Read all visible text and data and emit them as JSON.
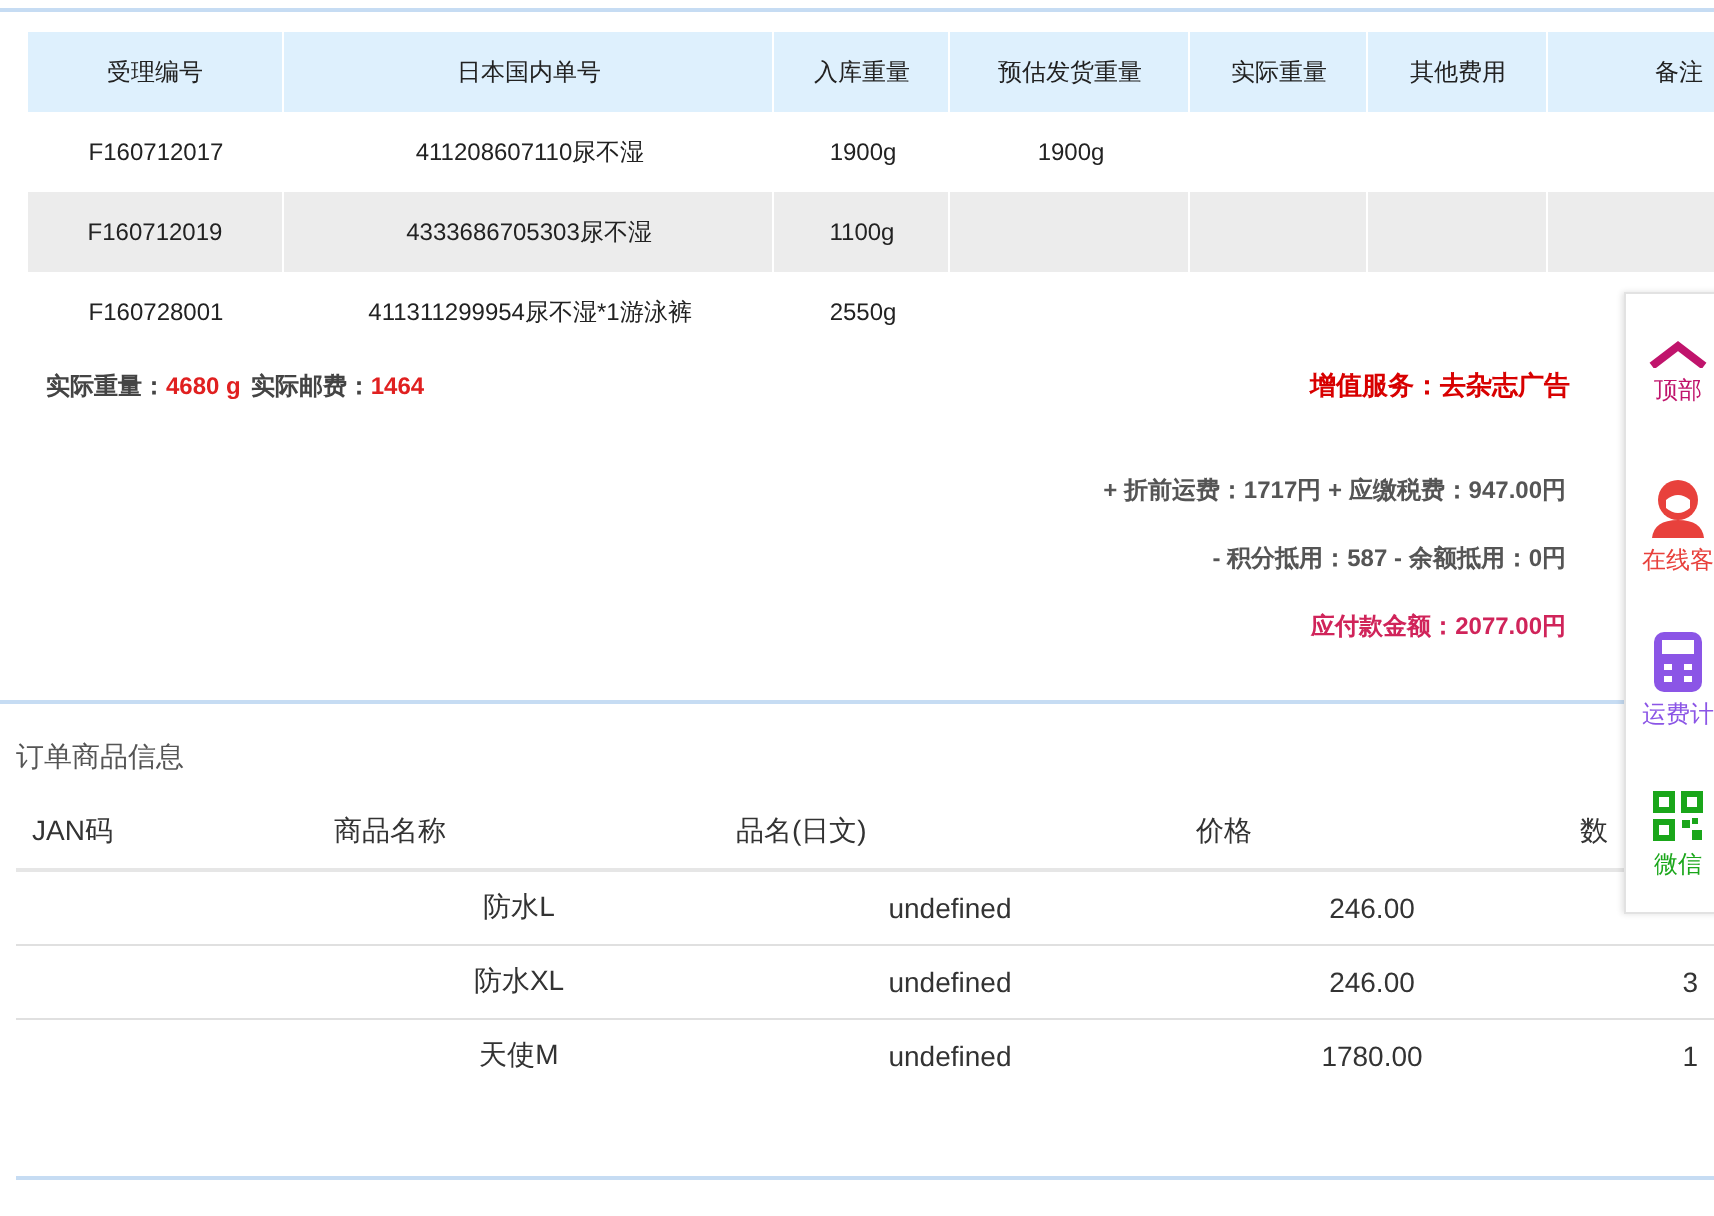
{
  "orders": {
    "columns": [
      "受理编号",
      "日本国内单号",
      "入库重量",
      "预估发货重量",
      "实际重量",
      "其他费用",
      "备注"
    ],
    "rows": [
      {
        "id": "F160712017",
        "tracking": "411208607110尿不湿",
        "inbound_weight": "1900g",
        "estimated_weight": "1900g"
      },
      {
        "id": "F160712019",
        "tracking": "4333686705303尿不湿",
        "inbound_weight": "1100g"
      },
      {
        "id": "F160728001",
        "tracking": "411311299954尿不湿*1游泳裤",
        "inbound_weight": "2550g"
      }
    ]
  },
  "summary": {
    "weight_label": "实际重量：",
    "weight": "4680 g",
    "postage_label": "实际邮费：",
    "postage": "1464",
    "service": "增值服务：去杂志广告"
  },
  "fees": {
    "lines": [
      "+ 折前运费：1717円 + 应缴税费：947.00円",
      "- 积分抵用：587 - 余额抵用：0円"
    ],
    "total": "应付款金额：2077.00円"
  },
  "goods": {
    "title": "订单商品信息",
    "columns": [
      "JAN码",
      "商品名称",
      "品名(日文)",
      "价格",
      "数"
    ],
    "rows": [
      {
        "name": "防水L",
        "name_jp": "undefined",
        "price": "246.00"
      },
      {
        "name": "防水XL",
        "name_jp": "undefined",
        "price": "246.00",
        "quantity": "3"
      },
      {
        "name": "天使M",
        "name_jp": "undefined",
        "price": "1780.00",
        "quantity": "1"
      }
    ]
  },
  "sidebar": {
    "items": [
      {
        "kind": "top",
        "label": "顶部"
      },
      {
        "kind": "service",
        "label": "在线客"
      },
      {
        "kind": "calc",
        "label": "运费计"
      },
      {
        "kind": "wechat",
        "label": "微信"
      }
    ]
  }
}
